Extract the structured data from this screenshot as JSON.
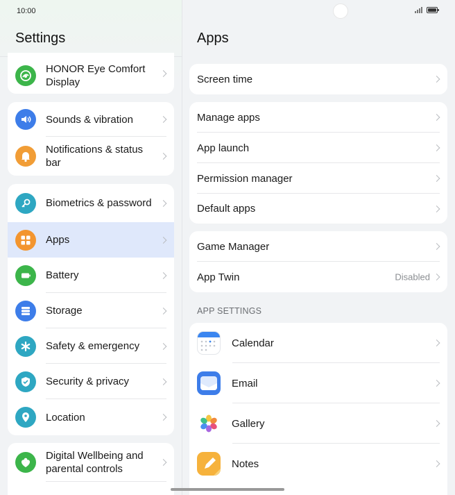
{
  "status": {
    "time": "10:00"
  },
  "left": {
    "title": "Settings",
    "groups": [
      [
        {
          "label": "HONOR Eye Comfort Display",
          "icon": "eye-comfort-icon",
          "color": "#3cb54a"
        }
      ],
      [
        {
          "label": "Sounds & vibration",
          "icon": "speaker-icon",
          "color": "#3d7de9"
        },
        {
          "label": "Notifications & status bar",
          "icon": "bell-icon",
          "color": "#f19d36"
        }
      ],
      [
        {
          "label": "Biometrics & password",
          "icon": "key-icon",
          "color": "#2ea7c2"
        },
        {
          "label": "Apps",
          "icon": "apps-grid-icon",
          "color": "#f3952f",
          "selected": true
        },
        {
          "label": "Battery",
          "icon": "battery-icon",
          "color": "#3cb54a"
        },
        {
          "label": "Storage",
          "icon": "storage-icon",
          "color": "#3d7de9"
        },
        {
          "label": "Safety & emergency",
          "icon": "asterisk-icon",
          "color": "#2ea7c2"
        },
        {
          "label": "Security & privacy",
          "icon": "shield-check-icon",
          "color": "#2ea7c2"
        },
        {
          "label": "Location",
          "icon": "location-pin-icon",
          "color": "#2ea7c2"
        }
      ],
      [
        {
          "label": "Digital Wellbeing and parental controls",
          "icon": "wellbeing-icon",
          "color": "#3cb54a"
        }
      ]
    ]
  },
  "right": {
    "title": "Apps",
    "group1": [
      {
        "label": "Screen time"
      }
    ],
    "group2": [
      {
        "label": "Manage apps"
      },
      {
        "label": "App launch"
      },
      {
        "label": "Permission manager"
      },
      {
        "label": "Default apps"
      }
    ],
    "group3": [
      {
        "label": "Game Manager"
      },
      {
        "label": "App Twin",
        "value": "Disabled"
      }
    ],
    "section_label": "APP SETTINGS",
    "app_settings": [
      {
        "label": "Calendar",
        "icon": "calendar-icon"
      },
      {
        "label": "Email",
        "icon": "email-icon"
      },
      {
        "label": "Gallery",
        "icon": "gallery-icon"
      },
      {
        "label": "Notes",
        "icon": "notes-icon"
      }
    ]
  }
}
